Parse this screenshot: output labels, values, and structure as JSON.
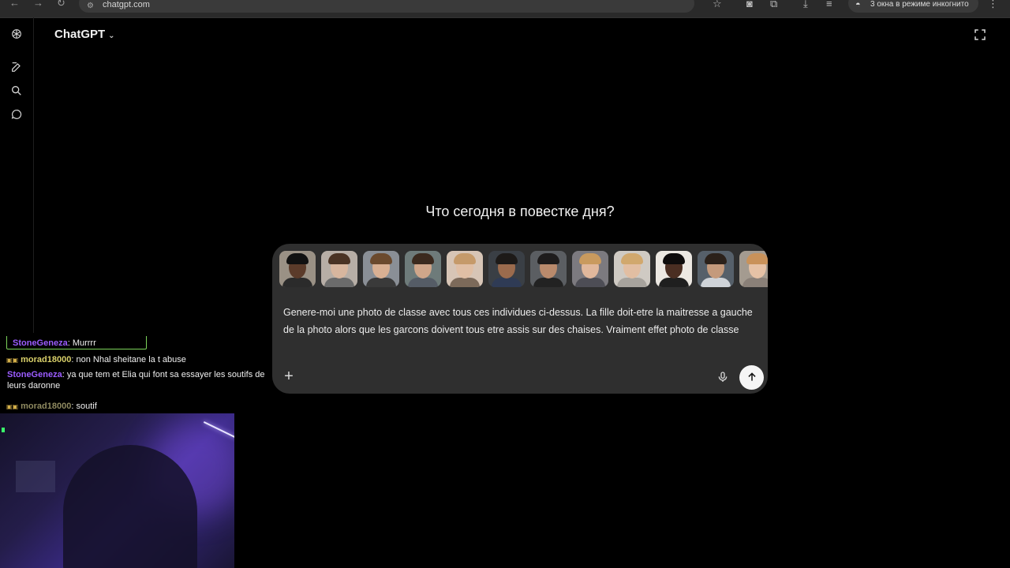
{
  "browser": {
    "url": "chatgpt.com",
    "incognito_label": "3 окна в режиме инкогнито"
  },
  "app": {
    "title": "ChatGPT",
    "headline": "Что сегодня в повестке дня?"
  },
  "composer": {
    "thumbnails": [
      {
        "skin": "#5b3b2a",
        "hair": "#111111",
        "shirt": "#2b2b2b",
        "bg": "#9a9185"
      },
      {
        "skin": "#d8b69e",
        "hair": "#4a3324",
        "shirt": "#6b6b6b",
        "bg": "#b7aea6"
      },
      {
        "skin": "#d9b093",
        "hair": "#6b4a2e",
        "shirt": "#3a3a3a",
        "bg": "#8a8f96"
      },
      {
        "skin": "#d0a68a",
        "hair": "#3b2a1e",
        "shirt": "#555c66",
        "bg": "#6e7b7a"
      },
      {
        "skin": "#e0bfa5",
        "hair": "#c59a6a",
        "shirt": "#7c6a5a",
        "bg": "#d7c5b6"
      },
      {
        "skin": "#9b6b4d",
        "hair": "#1d1a18",
        "shirt": "#2f3b55",
        "bg": "#3a3f45"
      },
      {
        "skin": "#b98a6c",
        "hair": "#1e1c1c",
        "shirt": "#222222",
        "bg": "#5b5e62"
      },
      {
        "skin": "#e1b89c",
        "hair": "#c99a5e",
        "shirt": "#4d4d55",
        "bg": "#7c7a7f"
      },
      {
        "skin": "#e2bea2",
        "hair": "#d1a86d",
        "shirt": "#a7a39d",
        "bg": "#cfcac3"
      },
      {
        "skin": "#4a2e22",
        "hair": "#0e0c0c",
        "shirt": "#1f1f1f",
        "bg": "#ece8e2"
      },
      {
        "skin": "#c49a7c",
        "hair": "#2b211a",
        "shirt": "#cfd3d8",
        "bg": "#56606a"
      },
      {
        "skin": "#e6c2a6",
        "hair": "#c9925a",
        "shirt": "#8a8078",
        "bg": "#a49b90"
      }
    ],
    "prompt": "Genere-moi une photo de classe avec tous ces individues ci-dessus. La fille doit-etre la maitresse a gauche de la photo alors que les garcons doivent tous etre assis sur des chaises. Vraiment effet photo de classe",
    "add_label": "+"
  },
  "chat": {
    "highlight": {
      "user": "StoneGeneza",
      "sep": ": ",
      "text": "Murrrr",
      "user_color": "#9b5cff"
    },
    "messages": [
      {
        "user": "morad18000",
        "sep": ": ",
        "text": "non Nhal sheitane la t abuse",
        "user_color": "#d9d06a",
        "badge": "▣▣"
      },
      {
        "user": "StoneGeneza",
        "sep": ": ",
        "text": "ya que tem et Elia qui font sa essayer les soutifs de leurs daronne",
        "user_color": "#9b5cff",
        "badge": ""
      },
      {
        "user": "morad18000",
        "sep": ": ",
        "text": "soutif",
        "user_color": "#8f8a60",
        "badge": "▣▣"
      }
    ]
  },
  "colors": {
    "background": "#000000",
    "composer_bg": "#2f2f2f",
    "send_bg": "#f5f5f5"
  }
}
